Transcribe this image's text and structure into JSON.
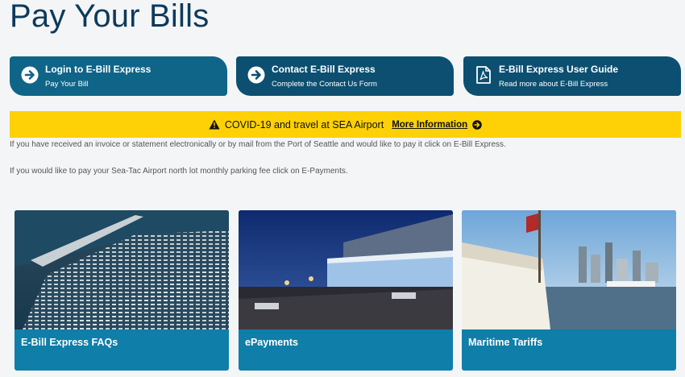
{
  "page": {
    "title": "Pay Your Bills"
  },
  "actions": [
    {
      "title": "Login to E-Bill Express",
      "subtitle": "Pay Your Bill",
      "icon": "arrow-right-circle-icon"
    },
    {
      "title": "Contact E-Bill Express",
      "subtitle": "Complete the Contact Us Form",
      "icon": "arrow-right-circle-icon"
    },
    {
      "title": "E-Bill Express User Guide",
      "subtitle": "Read more about E-Bill Express",
      "icon": "pdf-file-icon"
    }
  ],
  "banner": {
    "text": "COVID-19 and travel at SEA Airport",
    "link": "More Information",
    "color": "#fdd106"
  },
  "content": {
    "paragraph1": "If you have received an invoice or statement electronically or by mail from the Port of Seattle and would like to pay it click on E-Bill Express.",
    "paragraph2": "If you would like to pay your Sea-Tac Airport north lot monthly parking fee click on E-Payments."
  },
  "cards": [
    {
      "label": "E-Bill Express FAQs",
      "image": "marina-aerial-photo"
    },
    {
      "label": "ePayments",
      "image": "airport-terminal-night-photo"
    },
    {
      "label": "Maritime Tariffs",
      "image": "ship-cle-illahee-photo"
    }
  ],
  "colors": {
    "title": "#0d3a5c",
    "card": "#0f7ea8",
    "action": "#0c4f70"
  }
}
